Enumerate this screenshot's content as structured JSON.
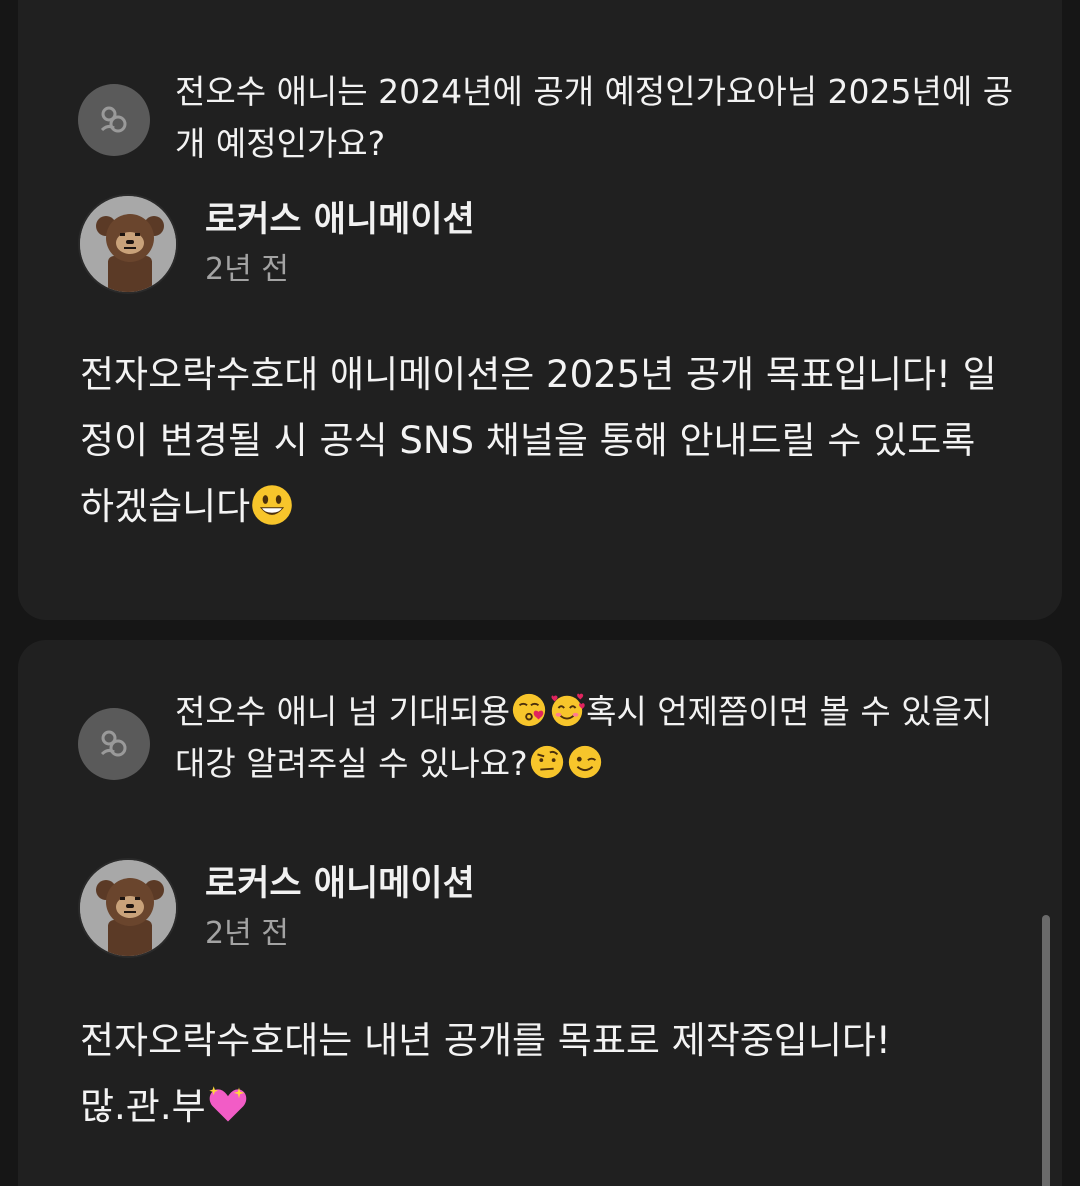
{
  "threads": [
    {
      "question": "전오수 애니는 2024년에 공개 예정인가요아님 2025년에 공개 예정인가요?",
      "question_emojis": [],
      "reply": {
        "author": "로커스 애니메이션",
        "time": "2년 전",
        "body": "전자오락수호대 애니메이션은 2025년 공개 목표입니다! 일정이 변경될 시 공식 SNS 채널을 통해 안내드릴 수 있도록 하겠습니다",
        "body_emoji": "grinning-face-emoji"
      }
    },
    {
      "question_part1": "전오수 애니 넘 기대되용",
      "question_part2": "혹시 언제쯤이면 볼 수 있을지 대강 알려주실 수 있나요?",
      "question_emojis": [
        "kissing-heart-emoji",
        "smiling-hearts-emoji",
        "raised-eyebrow-emoji",
        "winking-emoji"
      ],
      "reply": {
        "author": "로커스 애니메이션",
        "time": "2년 전",
        "body_line1": "전자오락수호대는 내년 공개를 목표로 제작중입니다!",
        "body_line2": "많.관.부",
        "body_emoji": "sparkling-heart-emoji"
      }
    }
  ],
  "colors": {
    "background": "#161616",
    "card": "#202020",
    "text": "#f1f1f1",
    "muted": "#a3a3a3",
    "avatar_placeholder": "#5a5a5a"
  }
}
